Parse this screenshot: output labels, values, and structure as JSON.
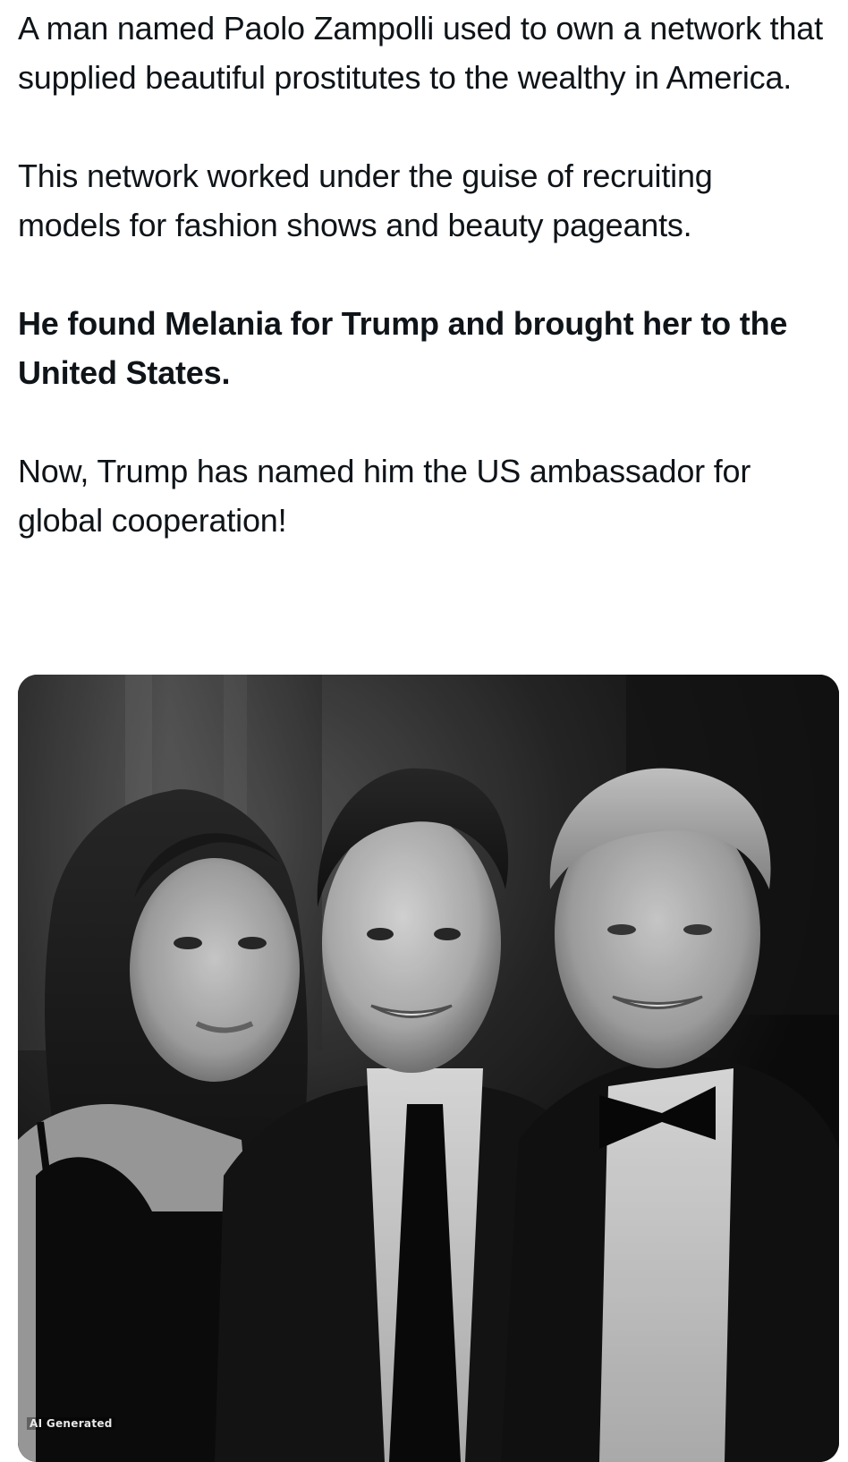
{
  "post": {
    "paragraphs": [
      {
        "text": "A man named Paolo Zampolli used to own a network that supplied beautiful prostitutes to the wealthy in America.",
        "bold": false
      },
      {
        "text": "This network worked under the guise of recruiting models for fashion shows and beauty pageants.",
        "bold": false
      },
      {
        "text": "He found Melania for Trump and brought her to the United States.",
        "bold": true
      },
      {
        "text": "Now, Trump has named him the US ambassador for global cooperation!",
        "bold": false
      }
    ]
  },
  "media": {
    "kind": "black-and-white photo",
    "watermark": "AI Generated"
  }
}
